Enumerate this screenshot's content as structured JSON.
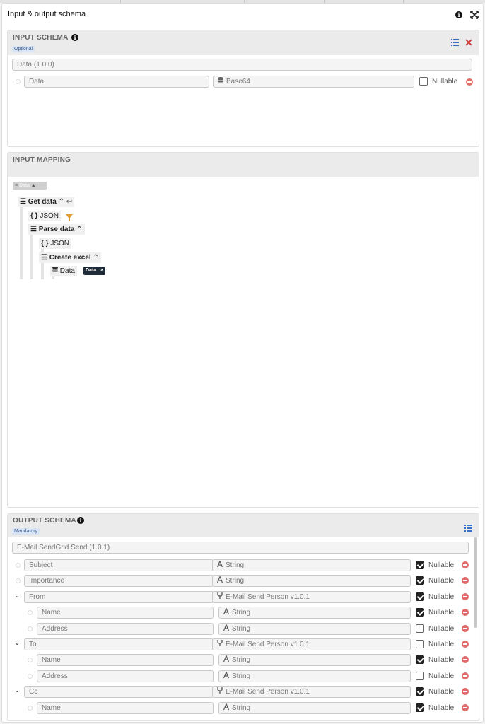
{
  "window": {
    "title": "Input & output schema",
    "icons": [
      "info-icon",
      "expand-icon"
    ]
  },
  "input_schema": {
    "title": "INPUT SCHEMA",
    "badge": "Optional",
    "root_name": "Data (1.0.0)",
    "fields": [
      {
        "name": "Data",
        "type": "Base64",
        "type_icon": "database-icon",
        "nullable_label": "Nullable",
        "nullable": false
      }
    ]
  },
  "input_mapping": {
    "title": "INPUT MAPPING",
    "source_chip": "Data",
    "tree": [
      {
        "label": "Get data",
        "kind": "list",
        "bold": true,
        "expanded": true,
        "extra_icon": "link-icon"
      },
      {
        "label": "JSON",
        "kind": "json",
        "filter_icon": true
      },
      {
        "label": "Parse data",
        "kind": "list",
        "bold": true,
        "expanded": true
      },
      {
        "label": "JSON",
        "kind": "json"
      },
      {
        "label": "Create excel",
        "kind": "list",
        "bold": true,
        "expanded": true
      },
      {
        "label": "Data",
        "kind": "database",
        "mapped_chip": "Data"
      }
    ]
  },
  "output_schema": {
    "title": "OUTPUT SCHEMA",
    "badge": "Mandatory",
    "root_name": "E-Mail SendGrid Send (1.0.1)",
    "nullable_label": "Nullable",
    "rows": [
      {
        "name": "Subject",
        "type": "String",
        "type_icon": "text-icon",
        "nullable": true,
        "level": 0,
        "expandable": false
      },
      {
        "name": "Importance",
        "type": "String",
        "type_icon": "text-icon",
        "nullable": true,
        "level": 0,
        "expandable": false
      },
      {
        "name": "From",
        "type": "E-Mail Send Person v1.0.1",
        "type_icon": "branch-icon",
        "nullable": true,
        "level": 0,
        "expandable": true
      },
      {
        "name": "Name",
        "type": "String",
        "type_icon": "text-icon",
        "nullable": true,
        "level": 1,
        "expandable": false
      },
      {
        "name": "Address",
        "type": "String",
        "type_icon": "text-icon",
        "nullable": false,
        "level": 1,
        "expandable": false
      },
      {
        "name": "To",
        "type": "E-Mail Send Person v1.0.1",
        "type_icon": "branch-icon",
        "nullable": false,
        "level": 0,
        "expandable": true
      },
      {
        "name": "Name",
        "type": "String",
        "type_icon": "text-icon",
        "nullable": true,
        "level": 1,
        "expandable": false
      },
      {
        "name": "Address",
        "type": "String",
        "type_icon": "text-icon",
        "nullable": false,
        "level": 1,
        "expandable": false
      },
      {
        "name": "Cc",
        "type": "E-Mail Send Person v1.0.1",
        "type_icon": "branch-icon",
        "nullable": true,
        "level": 0,
        "expandable": true
      },
      {
        "name": "Name",
        "type": "String",
        "type_icon": "text-icon",
        "nullable": true,
        "level": 1,
        "expandable": false
      }
    ]
  }
}
